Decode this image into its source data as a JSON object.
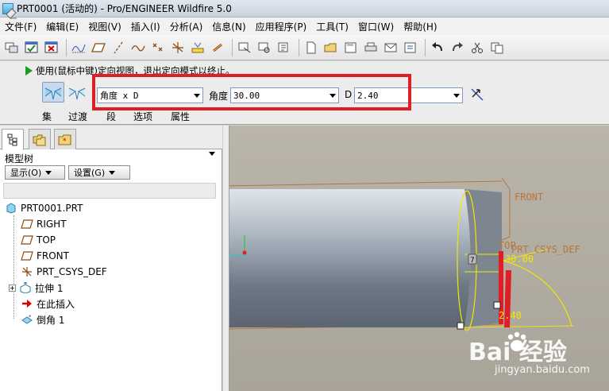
{
  "window": {
    "title": "PRT0001 (活动的) - Pro/ENGINEER Wildfire 5.0"
  },
  "menu": [
    "文件(F)",
    "编辑(E)",
    "视图(V)",
    "插入(I)",
    "分析(A)",
    "信息(N)",
    "应用程序(P)",
    "工具(T)",
    "窗口(W)",
    "帮助(H)"
  ],
  "dashboard": {
    "prompt": "使用(鼠标中键)定向视图，退出定向模式以终止。",
    "scheme": {
      "value": "角度 x D"
    },
    "angle": {
      "label": "角度",
      "value": "30.00"
    },
    "distance": {
      "label": "D",
      "value": "2.40"
    },
    "tabs": [
      "集",
      "过渡",
      "段",
      "选项",
      "属性"
    ]
  },
  "panel": {
    "title": "模型树",
    "show_button": "显示(O)",
    "settings_button": "设置(G)"
  },
  "tree": [
    {
      "label": "PRT0001.PRT",
      "icon": "part-icon"
    },
    {
      "label": "RIGHT",
      "icon": "datum-plane-icon"
    },
    {
      "label": "TOP",
      "icon": "datum-plane-icon"
    },
    {
      "label": "FRONT",
      "icon": "datum-plane-icon"
    },
    {
      "label": "PRT_CSYS_DEF",
      "icon": "csys-icon"
    },
    {
      "label": "拉伸 1",
      "icon": "extrude-icon"
    },
    {
      "label": "在此插入",
      "icon": "insert-here-arrow-icon"
    },
    {
      "label": "倒角 1",
      "icon": "chamfer-icon"
    }
  ],
  "viewport": {
    "labels": {
      "front": "FRONT",
      "top": "TOP",
      "csys": "PRT_CSYS_DEF",
      "angle": "30.00",
      "distance": "2.40",
      "handle": "7"
    }
  },
  "watermark": {
    "brand": "Bai  经验",
    "url": "jingyan.baidu.com"
  },
  "colors": {
    "highlight": "#e01e25",
    "yellow": "#f2e600",
    "datum": "#b8743a"
  }
}
